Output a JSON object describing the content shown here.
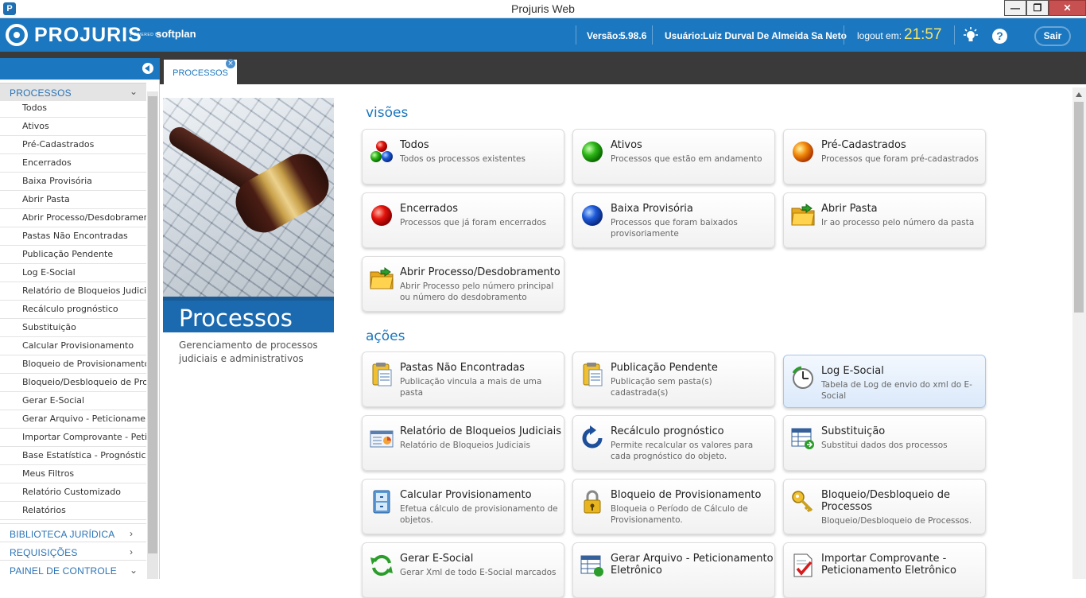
{
  "window": {
    "title": "Projuris Web",
    "minimize": "—",
    "restore": "❐",
    "close": "✕"
  },
  "header": {
    "brand": "PROJURIS",
    "powered_by": "POWERED BY",
    "partner": "softplan",
    "version_label": "Versão:",
    "version": "5.98.6",
    "user_label": "Usuário:",
    "user": "Luiz Durval De Almeida Sa Neto",
    "logout_label": "logout em:",
    "logout_time": "21:57",
    "help": "?",
    "logout_button": "Sair",
    "accent_color": "#1b77bf",
    "clock_color": "#f3e46b"
  },
  "sidebar": {
    "active_section": "PROCESSOS",
    "items": [
      "Todos",
      "Ativos",
      "Pré-Cadastrados",
      "Encerrados",
      "Baixa Provisória",
      "Abrir Pasta",
      "Abrir Processo/Desdobramento",
      "Pastas Não Encontradas",
      "Publicação Pendente",
      "Log E-Social",
      "Relatório de Bloqueios Judiciais",
      "Recálculo prognóstico",
      "Substituição",
      "Calcular Provisionamento",
      "Bloqueio de Provisionamento",
      "Bloqueio/Desbloqueio de Processos",
      "Gerar E-Social",
      "Gerar Arquivo - Peticionamento Eletrônico",
      "Importar Comprovante - Peticionamento Eletrônico",
      "Base Estatística - Prognóstico Inteligente",
      "Meus Filtros",
      "Relatório Customizado",
      "Relatórios"
    ],
    "sections": [
      "BIBLIOTECA JURÍDICA",
      "REQUISIÇÕES",
      "PAINEL DE CONTROLE"
    ]
  },
  "tabs": {
    "active": "PROCESSOS",
    "close": "×"
  },
  "panel": {
    "title": "Processos",
    "description": "Gerenciamento de processos judiciais e administrativos"
  },
  "main": {
    "views_title": "visões",
    "actions_title": "ações",
    "views": [
      {
        "title": "Todos",
        "desc": "Todos os processos existentes",
        "icon": "multi-ball-icon"
      },
      {
        "title": "Ativos",
        "desc": "Processos que estão em andamento",
        "icon": "green-ball-icon"
      },
      {
        "title": "Pré-Cadastrados",
        "desc": "Processos que foram pré-cadastrados",
        "icon": "orange-ball-icon"
      },
      {
        "title": "Encerrados",
        "desc": "Processos que já foram encerrados",
        "icon": "red-ball-icon"
      },
      {
        "title": "Baixa Provisória",
        "desc": "Processos que foram baixados provisoriamente",
        "icon": "blue-ball-icon"
      },
      {
        "title": "Abrir Pasta",
        "desc": "Ir ao processo pelo número da pasta",
        "icon": "folder-icon"
      },
      {
        "title": "Abrir Processo/Desdobramento",
        "desc": "Abrir Processo pelo número principal ou número do desdobramento",
        "icon": "folder-icon"
      }
    ],
    "actions": [
      {
        "title": "Pastas Não Encontradas",
        "desc": "Publicação vincula a mais de uma pasta",
        "icon": "clipboard-icon"
      },
      {
        "title": "Publicação Pendente",
        "desc": "Publicação sem pasta(s) cadastrada(s)",
        "icon": "clipboard-icon"
      },
      {
        "title": "Log E-Social",
        "desc": "Tabela de Log de envio do xml do E-Social",
        "icon": "log-clock-icon"
      },
      {
        "title": "Relatório de Bloqueios Judiciais",
        "desc": "Relatório de Bloqueios Judiciais",
        "icon": "report-icon"
      },
      {
        "title": "Recálculo prognóstico",
        "desc": "Permite recalcular os valores para cada prognóstico do objeto.",
        "icon": "refresh-icon"
      },
      {
        "title": "Substituição",
        "desc": "Substitui dados dos processos",
        "icon": "table-swap-icon"
      },
      {
        "title": "Calcular Provisionamento",
        "desc": "Efetua cálculo de provisionamento de objetos.",
        "icon": "cabinet-icon"
      },
      {
        "title": "Bloqueio de Provisionamento",
        "desc": "Bloqueia o Período de Cálculo de Provisionamento.",
        "icon": "lock-icon"
      },
      {
        "title": "Bloqueio/Desbloqueio de Processos",
        "desc": "Bloqueio/Desbloqueio de Processos.",
        "icon": "key-icon"
      },
      {
        "title": "Gerar E-Social",
        "desc": "Gerar Xml de todo E-Social marcados",
        "icon": "green-refresh-icon"
      },
      {
        "title": "Gerar Arquivo - Peticionamento Eletrônico",
        "desc": "",
        "icon": "table-gear-icon"
      },
      {
        "title": "Importar Comprovante - Peticionamento Eletrônico",
        "desc": "",
        "icon": "document-check-icon"
      }
    ]
  }
}
